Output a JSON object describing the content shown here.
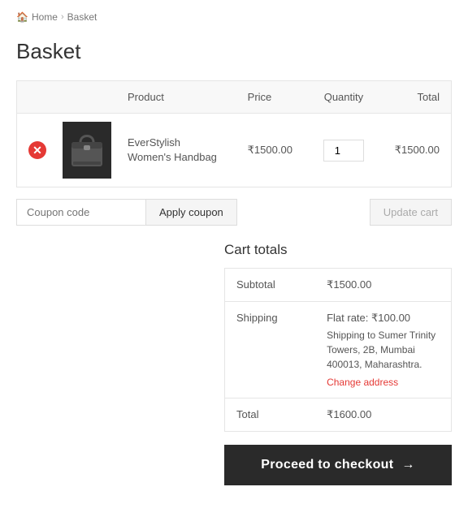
{
  "breadcrumb": {
    "home_label": "Home",
    "basket_label": "Basket",
    "separator": "›"
  },
  "page_title": "Basket",
  "table": {
    "headers": {
      "product": "Product",
      "price": "Price",
      "quantity": "Quantity",
      "total": "Total"
    },
    "rows": [
      {
        "product_name": "EverStylish Women's Handbag",
        "price": "₹1500.00",
        "quantity": 1,
        "total": "₹1500.00"
      }
    ]
  },
  "coupon": {
    "placeholder": "Coupon code",
    "apply_label": "Apply coupon"
  },
  "update_cart_label": "Update cart",
  "cart_totals": {
    "title": "Cart totals",
    "subtotal_label": "Subtotal",
    "subtotal_value": "₹1500.00",
    "shipping_label": "Shipping",
    "shipping_rate": "Flat rate: ₹100.00",
    "shipping_address": "Shipping to Sumer Trinity Towers, 2B, Mumbai 400013, Maharashtra.",
    "change_address_label": "Change address",
    "total_label": "Total",
    "total_value": "₹1600.00"
  },
  "checkout": {
    "button_label": "Proceed to checkout",
    "arrow": "→"
  }
}
